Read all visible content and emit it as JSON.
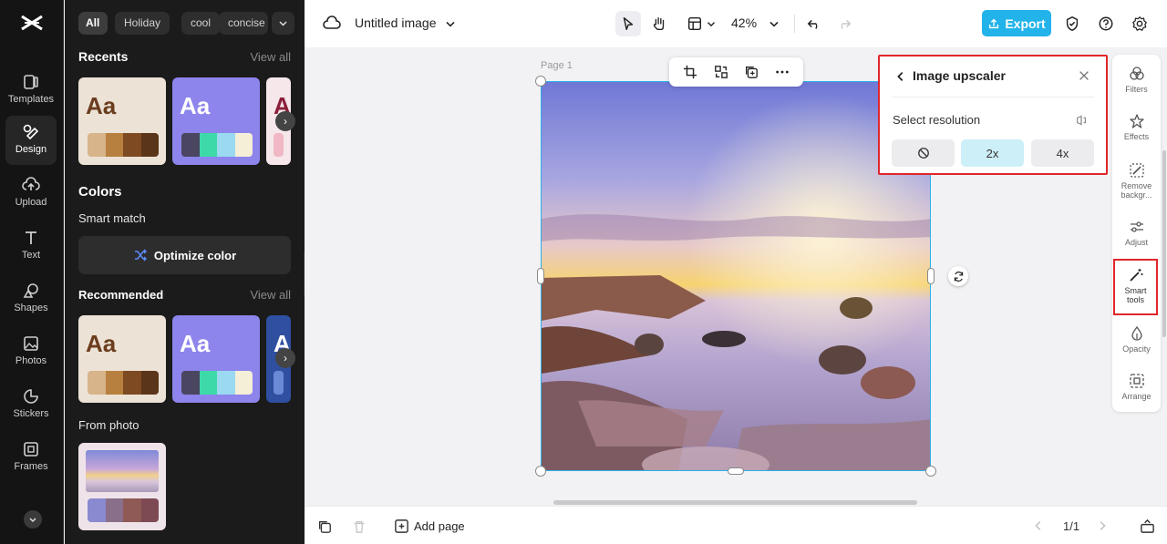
{
  "rail": {
    "items": [
      {
        "label": "Templates",
        "icon": "templates-icon"
      },
      {
        "label": "Design",
        "icon": "design-icon"
      },
      {
        "label": "Upload",
        "icon": "upload-icon"
      },
      {
        "label": "Text",
        "icon": "text-icon"
      },
      {
        "label": "Shapes",
        "icon": "shapes-icon"
      },
      {
        "label": "Photos",
        "icon": "photos-icon"
      },
      {
        "label": "Stickers",
        "icon": "stickers-icon"
      },
      {
        "label": "Frames",
        "icon": "frames-icon"
      }
    ],
    "active": "Design"
  },
  "panel": {
    "chips": [
      "All",
      "Holiday",
      "cool",
      "concise"
    ],
    "recents": {
      "title": "Recents",
      "link": "View all"
    },
    "colors_title": "Colors",
    "smart_match": "Smart match",
    "optimize_label": "Optimize color",
    "recommended": {
      "title": "Recommended",
      "link": "View all"
    },
    "from_photo": "From photo",
    "card_text": "Aa"
  },
  "topbar": {
    "doc_title": "Untitled image",
    "zoom": "42%",
    "export_label": "Export"
  },
  "canvas": {
    "page_label": "Page 1"
  },
  "upscaler": {
    "title": "Image upscaler",
    "resolution_label": "Select resolution",
    "options": [
      "2x",
      "4x"
    ],
    "selected": "2x"
  },
  "tools": {
    "items": [
      "Filters",
      "Effects",
      "Remove backgr...",
      "Adjust",
      "Smart tools",
      "Opacity",
      "Arrange"
    ]
  },
  "bottombar": {
    "add_page": "Add page",
    "pager": "1/1"
  },
  "colors": {
    "accent": "#22b3ea",
    "highlight": "#e0262b"
  }
}
